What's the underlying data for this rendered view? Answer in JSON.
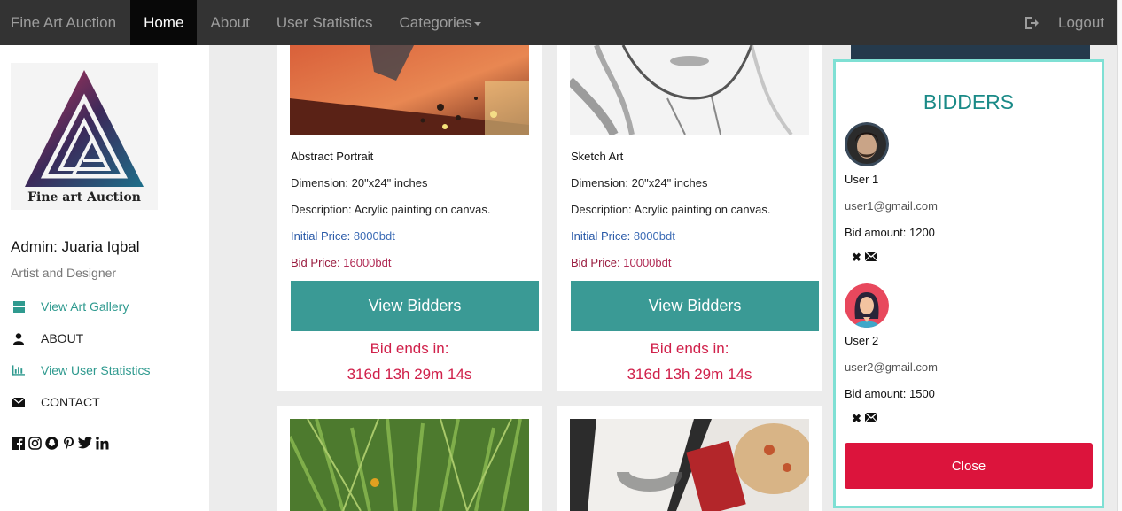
{
  "navbar": {
    "brand": "Fine Art Auction",
    "items": [
      "Home",
      "About",
      "User Statistics",
      "Categories"
    ],
    "logout": "Logout"
  },
  "sidebar": {
    "logo_text": "Fine art Auction",
    "admin_name": "Admin: Juaria Iqbal",
    "role": "Artist and Designer",
    "menu": [
      {
        "label": "View Art Gallery",
        "icon": "grid-icon"
      },
      {
        "label": "ABOUT",
        "icon": "user-icon"
      },
      {
        "label": "View User Statistics",
        "icon": "bar-chart-icon"
      },
      {
        "label": "CONTACT",
        "icon": "envelope-icon"
      }
    ],
    "social": [
      "facebook-icon",
      "instagram-icon",
      "snapchat-icon",
      "pinterest-icon",
      "twitter-icon",
      "linkedin-icon"
    ]
  },
  "cards": [
    {
      "title": "Abstract Portrait",
      "dimension": "Dimension: 20\"x24\" inches",
      "description": "Description: Acrylic painting on canvas.",
      "initial_label": "Initial Price:",
      "initial_value": "8000bdt",
      "bid_label": "Bid Price:",
      "bid_value": "16000bdt",
      "button": "View Bidders",
      "ends_label": "Bid ends in:",
      "countdown": "316d 13h 29m 14s"
    },
    {
      "title": "Sketch Art",
      "dimension": "Dimension: 20\"x24\" inches",
      "description": "Description: Acrylic painting on canvas.",
      "initial_label": "Initial Price:",
      "initial_value": "8000bdt",
      "bid_label": "Bid Price:",
      "bid_value": "10000bdt",
      "button": "View Bidders",
      "ends_label": "Bid ends in:",
      "countdown": "316d 13h 29m 14s"
    }
  ],
  "bidders": {
    "title": "BIDDERS",
    "list": [
      {
        "name": "User 1",
        "email": "user1@gmail.com",
        "amount": "Bid amount: 1200"
      },
      {
        "name": "User 2",
        "email": "user2@gmail.com",
        "amount": "Bid amount: 1500"
      }
    ],
    "close": "Close"
  },
  "colors": {
    "navbar_bg": "#333333",
    "teal": "#3a9a95",
    "crimson": "#dc143c",
    "panel_border": "#7fe0d4"
  }
}
